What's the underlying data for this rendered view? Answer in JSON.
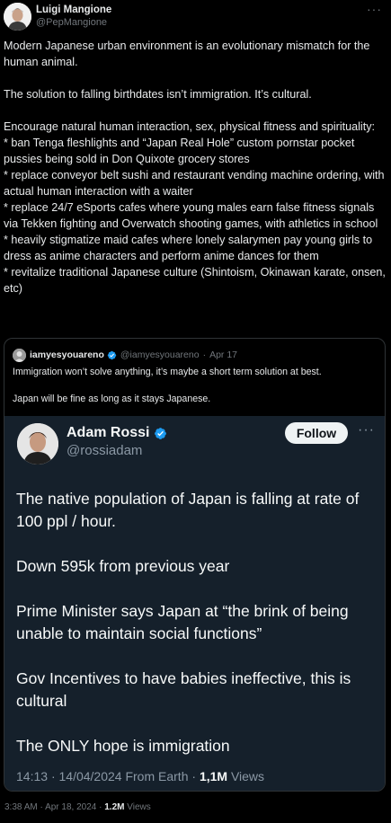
{
  "post": {
    "author_name": "Luigi Mangione",
    "author_handle": "@PepMangione",
    "more_icon": "···",
    "paragraphs": [
      "Modern Japanese urban environment is an evolutionary mismatch for the human animal.",
      "The solution to falling birthdates isn’t immigration. It’s cultural.",
      "Encourage natural human interaction, sex, physical fitness and spirituality:\n* ban Tenga fleshlights and “Japan Real Hole” custom pornstar pocket pussies being sold in Don Quixote grocery stores\n* replace conveyor belt sushi and restaurant vending machine ordering, with actual human interaction with a waiter\n* replace 24/7 eSports cafes where young males earn false fitness signals via Tekken fighting and Overwatch shooting games, with athletics in school\n* heavily stigmatize maid cafes where lonely salarymen pay young girls to dress as anime characters and perform anime dances for them\n* revitalize traditional Japanese culture (Shintoism, Okinawan karate, onsen, etc)"
    ],
    "time": "3:38 AM",
    "date": "Apr 18, 2024",
    "separator": "·",
    "views_count": "1.2M",
    "views_label": "Views"
  },
  "quote": {
    "author_name": "iamyesyouareno",
    "author_handle": "@iamyesyouareno",
    "separator": "·",
    "date": "Apr 17",
    "paragraphs": [
      "Immigration won’t solve anything, it’s maybe a short term solution at best.",
      "Japan will be fine as long as it stays Japanese."
    ],
    "card": {
      "author_name": "Adam Rossi",
      "author_handle": "@rossiadam",
      "follow_label": "Follow",
      "more_icon": "···",
      "paragraphs": [
        "The native population of Japan is falling at rate of 100 ppl / hour.",
        "Down 595k from previous year",
        "Prime Minister says Japan at “the brink of being unable to maintain social functions”",
        "Gov Incentives to have babies ineffective, this is cultural",
        "The ONLY hope is immigration"
      ],
      "time": "14:13",
      "separator": "·",
      "date": "14/04/2024",
      "source": "From Earth",
      "views_count": "1,1M",
      "views_label": "Views"
    }
  },
  "colors": {
    "background": "#000000",
    "card_background": "#15202b",
    "verified_blue": "#1d9bf0",
    "muted_text": "#71767b"
  },
  "icons": {
    "verified": "verified-badge-icon",
    "more": "more-options-icon"
  }
}
